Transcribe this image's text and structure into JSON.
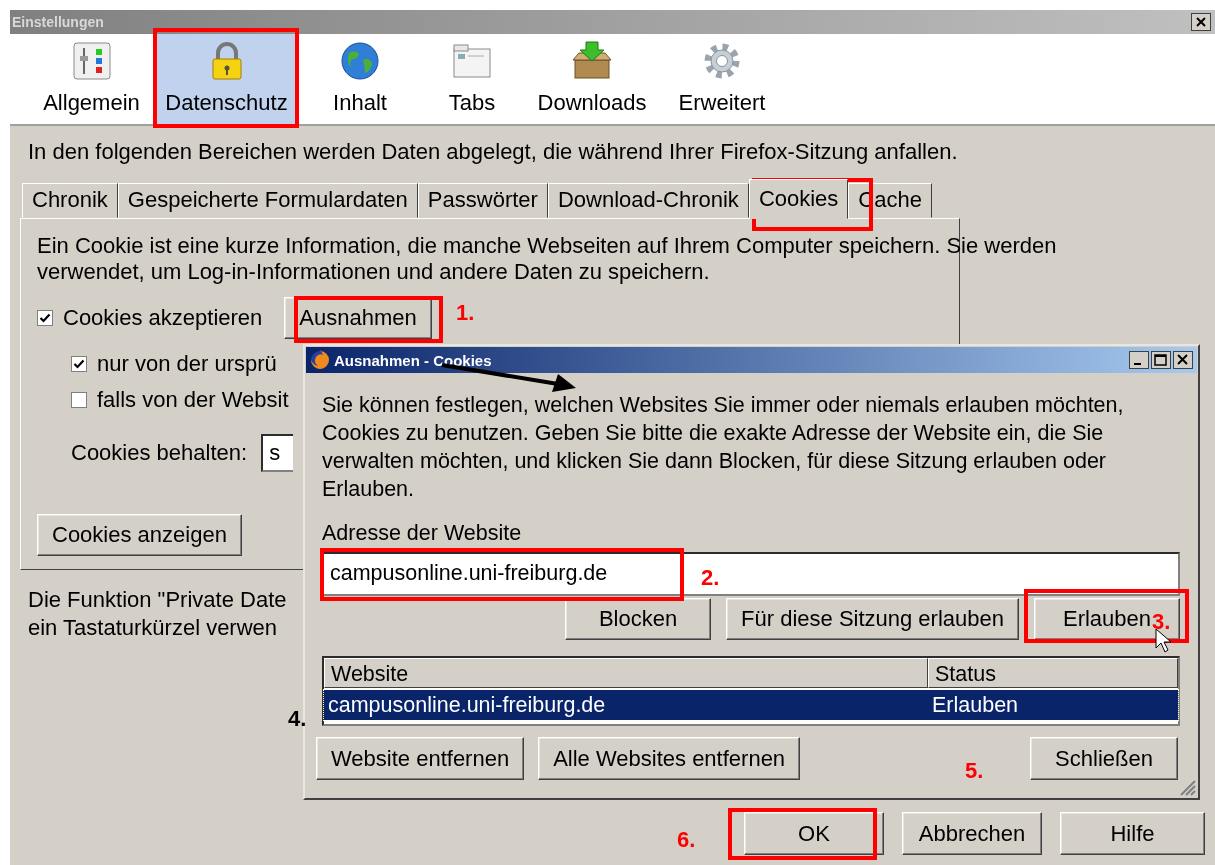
{
  "window": {
    "title": "Einstellungen"
  },
  "toolbar": [
    {
      "label": "Allgemein",
      "selected": false
    },
    {
      "label": "Datenschutz",
      "selected": true
    },
    {
      "label": "Inhalt",
      "selected": false
    },
    {
      "label": "Tabs",
      "selected": false
    },
    {
      "label": "Downloads",
      "selected": false
    },
    {
      "label": "Erweitert",
      "selected": false
    }
  ],
  "intro": "In den folgenden Bereichen werden Daten abgelegt, die während Ihrer Firefox-Sitzung anfallen.",
  "tabs": [
    {
      "label": "Chronik",
      "selected": false
    },
    {
      "label": "Gespeicherte Formulardaten",
      "selected": false
    },
    {
      "label": "Passwörter",
      "selected": false
    },
    {
      "label": "Download-Chronik",
      "selected": false
    },
    {
      "label": "Cookies",
      "selected": true
    },
    {
      "label": "Cache",
      "selected": false
    }
  ],
  "cookies_panel": {
    "description": "Ein Cookie ist eine kurze Information, die manche Webseiten auf Ihrem Computer speichern. Sie werden verwendet, um Log-in-Informationen und andere Daten zu speichern.",
    "accept": {
      "label": "Cookies akzeptieren",
      "checked": true
    },
    "exceptions_button": "Ausnahmen",
    "options": [
      {
        "label": "nur von der ursprü",
        "checked": true
      },
      {
        "label": "falls von der Websit",
        "checked": false
      }
    ],
    "keep": {
      "label": "Cookies behalten:",
      "value": "s"
    },
    "show_button": "Cookies anzeigen"
  },
  "footer_text": [
    "Die Funktion \"Private Date",
    "ein Tastaturkürzel verwen"
  ],
  "buttons": [
    "OK",
    "Abbrechen",
    "Hilfe"
  ],
  "dialog": {
    "title": "Ausnahmen - Cookies",
    "description": "Sie können festlegen, welchen Websites Sie immer oder niemals erlauben möchten, Cookies zu benutzen. Geben Sie bitte die exakte Adresse der Website ein, die Sie verwalten möchten, und klicken Sie dann Blocken, für diese Sitzung erlauben oder Erlauben.",
    "address_label": "Adresse der Website",
    "address_value": "campusonline.uni-freiburg.de",
    "action_buttons": [
      "Blocken",
      "Für diese Sitzung erlauben",
      "Erlauben"
    ],
    "table": {
      "columns": [
        "Website",
        "Status"
      ],
      "rows": [
        {
          "cells": [
            "campusonline.uni-freiburg.de",
            "Erlauben"
          ],
          "selected": true
        }
      ]
    },
    "remove_buttons": [
      "Website entfernen",
      "Alle Websites entfernen"
    ],
    "close_button": "Schließen"
  },
  "annotations": [
    {
      "label": "1.",
      "color": "#ff0000"
    },
    {
      "label": "2.",
      "color": "#ff0000"
    },
    {
      "label": "3.",
      "color": "#ff0000"
    },
    {
      "label": "4.",
      "color": "#000000"
    },
    {
      "label": "5.",
      "color": "#ff0000"
    },
    {
      "label": "6.",
      "color": "#ff0000"
    }
  ]
}
